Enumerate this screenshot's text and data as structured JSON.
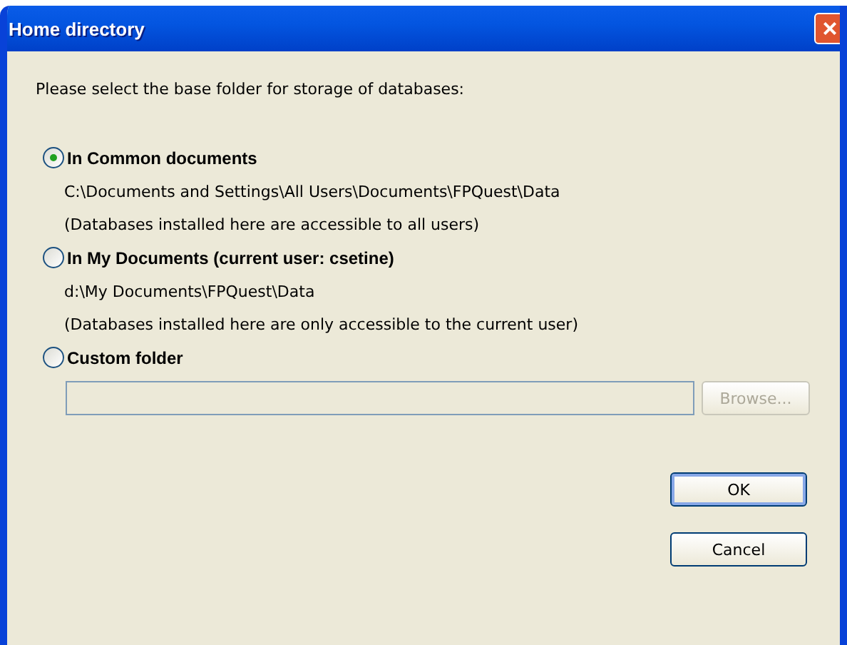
{
  "window": {
    "title": "Home directory",
    "close": "×"
  },
  "prompt": "Please select the base folder for storage of databases:",
  "options": [
    {
      "label": "In Common documents",
      "selected": true,
      "lines": [
        "C:\\Documents and Settings\\All Users\\Documents\\FPQuest\\Data",
        "(Databases installed here are accessible to all users)"
      ]
    },
    {
      "label": "In My Documents (current user: csetine)",
      "selected": false,
      "lines": [
        "d:\\My Documents\\FPQuest\\Data",
        "(Databases installed here are only accessible to the current user)"
      ]
    },
    {
      "label": "Custom folder",
      "selected": false
    }
  ],
  "custom_folder": {
    "disabled": true,
    "browse": {
      "label": "Browse...",
      "disabled": true
    }
  },
  "buttons": [
    {
      "label": "OK",
      "default": true
    },
    {
      "label": "Cancel",
      "default": false
    }
  ]
}
